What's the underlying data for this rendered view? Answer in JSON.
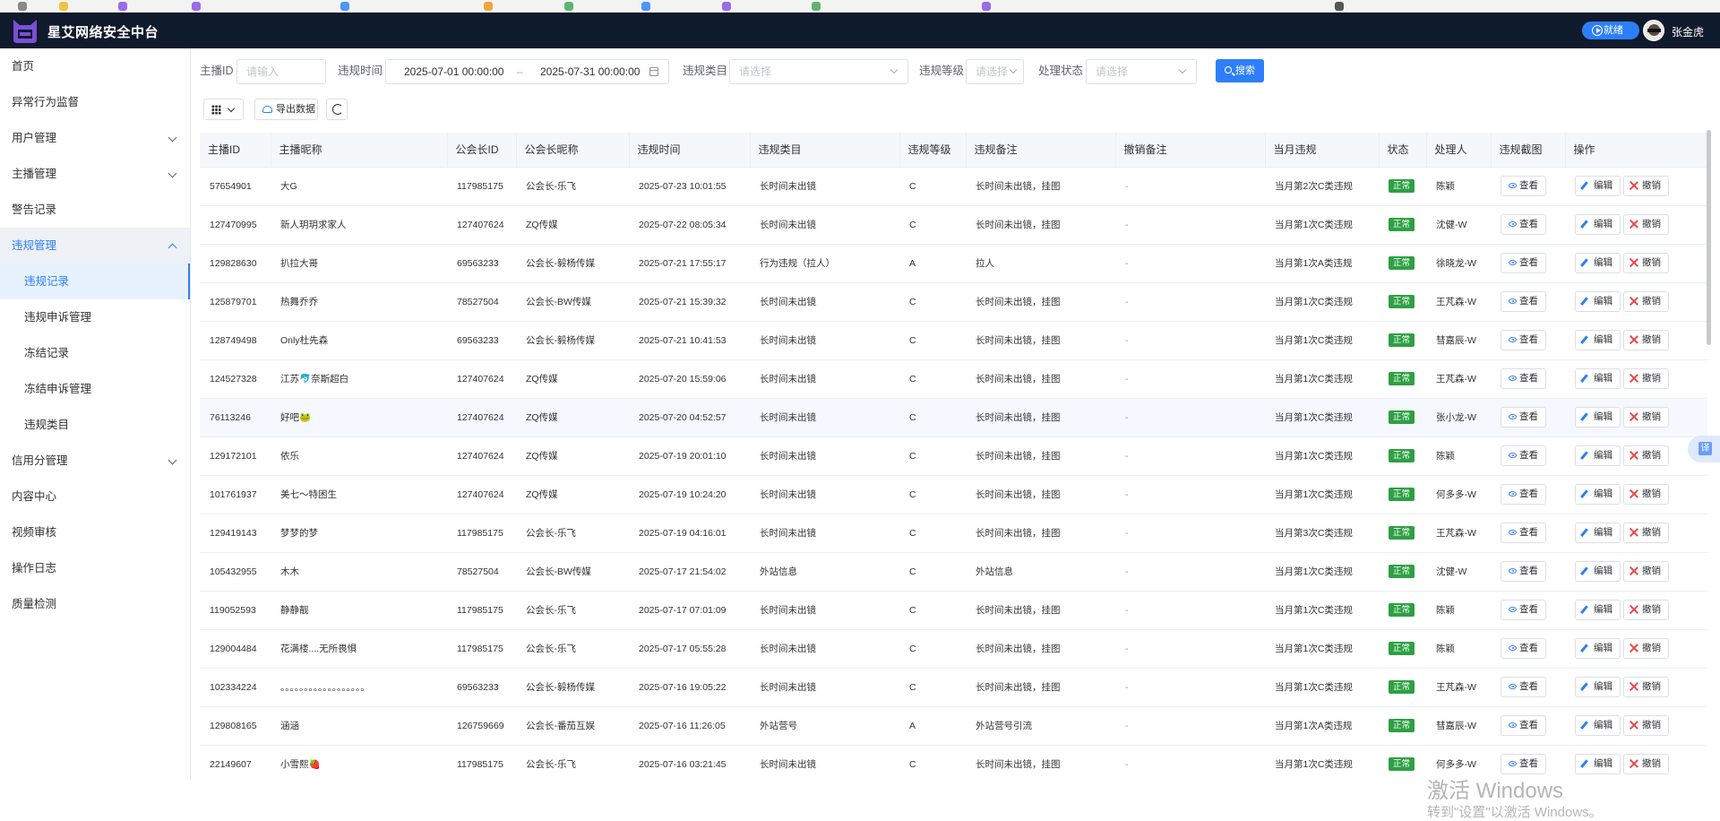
{
  "header": {
    "app_title": "星艾网络安全中台",
    "ready_label": "就绪",
    "user_name": "张金虎"
  },
  "sidebar": {
    "items": [
      {
        "label": "首页"
      },
      {
        "label": "异常行为监督"
      },
      {
        "label": "用户管理"
      },
      {
        "label": "主播管理"
      },
      {
        "label": "警告记录"
      },
      {
        "label": "违规管理"
      },
      {
        "label": "违规记录"
      },
      {
        "label": "违规申诉管理"
      },
      {
        "label": "冻结记录"
      },
      {
        "label": "冻结申诉管理"
      },
      {
        "label": "违规类目"
      },
      {
        "label": "信用分管理"
      },
      {
        "label": "内容中心"
      },
      {
        "label": "视频审核"
      },
      {
        "label": "操作日志"
      },
      {
        "label": "质量检测"
      }
    ]
  },
  "filters": {
    "anchor_id_label": "主播ID",
    "anchor_id_placeholder": "请输入",
    "time_label": "违规时间",
    "time_start": "2025-07-01 00:00:00",
    "time_sep": "–",
    "time_end": "2025-07-31 00:00:00",
    "category_label": "违规类目",
    "category_placeholder": "请选择",
    "level_label": "违规等级",
    "level_placeholder": "请选择",
    "status_label": "处理状态",
    "status_placeholder": "请选择",
    "search_label": "搜索"
  },
  "toolbar": {
    "export_label": "导出数据"
  },
  "table": {
    "columns": [
      "主播ID",
      "主播昵称",
      "公会长ID",
      "公会长昵称",
      "违规时间",
      "违规类目",
      "违规等级",
      "违规备注",
      "撤销备注",
      "当月违规",
      "状态",
      "处理人",
      "违规截图",
      "操作"
    ],
    "view_label": "查看",
    "edit_label": "编辑",
    "revoke_label": "撤销",
    "rows": [
      {
        "anchor_id": "57654901",
        "nickname": "大G",
        "guild_id": "117985175",
        "guild_name": "公会长-乐飞",
        "time": "2025-07-23 10:01:55",
        "category": "长时间未出镜",
        "level": "C",
        "remark": "长时间未出镜，挂图",
        "revoke_remark": "-",
        "monthly": "当月第2次C类违规",
        "status": "正常",
        "handler": "陈颖"
      },
      {
        "anchor_id": "127470995",
        "nickname": "新人玥玥求家人",
        "guild_id": "127407624",
        "guild_name": "ZQ传媒",
        "time": "2025-07-22 08:05:34",
        "category": "长时间未出镜",
        "level": "C",
        "remark": "长时间未出镜，挂图",
        "revoke_remark": "-",
        "monthly": "当月第1次C类违规",
        "status": "正常",
        "handler": "沈健-W"
      },
      {
        "anchor_id": "129828630",
        "nickname": "扒拉大哥",
        "guild_id": "69563233",
        "guild_name": "公会长-毅杨传媒",
        "time": "2025-07-21 17:55:17",
        "category": "行为违规（拉人）",
        "level": "A",
        "remark": "拉人",
        "revoke_remark": "-",
        "monthly": "当月第1次A类违规",
        "status": "正常",
        "handler": "徐晓龙-W"
      },
      {
        "anchor_id": "125879701",
        "nickname": "热舞乔乔",
        "guild_id": "78527504",
        "guild_name": "公会长-BW传媒",
        "time": "2025-07-21 15:39:32",
        "category": "长时间未出镜",
        "level": "C",
        "remark": "长时间未出镜，挂图",
        "revoke_remark": "-",
        "monthly": "当月第1次C类违规",
        "status": "正常",
        "handler": "王芃森-W"
      },
      {
        "anchor_id": "128749498",
        "nickname": "Only杜先森",
        "guild_id": "69563233",
        "guild_name": "公会长-毅杨传媒",
        "time": "2025-07-21 10:41:53",
        "category": "长时间未出镜",
        "level": "C",
        "remark": "长时间未出镜，挂图",
        "revoke_remark": "-",
        "monthly": "当月第1次C类违规",
        "status": "正常",
        "handler": "彗嘉辰-W"
      },
      {
        "anchor_id": "124527328",
        "nickname": "江苏🐬奈斯超白",
        "guild_id": "127407624",
        "guild_name": "ZQ传媒",
        "time": "2025-07-20 15:59:06",
        "category": "长时间未出镜",
        "level": "C",
        "remark": "长时间未出镜，挂图",
        "revoke_remark": "-",
        "monthly": "当月第1次C类违规",
        "status": "正常",
        "handler": "王芃森-W"
      },
      {
        "anchor_id": "76113246",
        "nickname": "好吧🐸",
        "guild_id": "127407624",
        "guild_name": "ZQ传媒",
        "time": "2025-07-20 04:52:57",
        "category": "长时间未出镜",
        "level": "C",
        "remark": "长时间未出镜，挂图",
        "revoke_remark": "-",
        "monthly": "当月第1次C类违规",
        "status": "正常",
        "handler": "张小龙-W"
      },
      {
        "anchor_id": "129172101",
        "nickname": "依乐",
        "guild_id": "127407624",
        "guild_name": "ZQ传媒",
        "time": "2025-07-19 20:01:10",
        "category": "长时间未出镜",
        "level": "C",
        "remark": "长时间未出镜，挂图",
        "revoke_remark": "-",
        "monthly": "当月第1次C类违规",
        "status": "正常",
        "handler": "陈颖"
      },
      {
        "anchor_id": "101761937",
        "nickname": "美七～特困生",
        "guild_id": "127407624",
        "guild_name": "ZQ传媒",
        "time": "2025-07-19 10:24:20",
        "category": "长时间未出镜",
        "level": "C",
        "remark": "长时间未出镜，挂图",
        "revoke_remark": "-",
        "monthly": "当月第1次C类违规",
        "status": "正常",
        "handler": "何多多-W"
      },
      {
        "anchor_id": "129419143",
        "nickname": "梦梦的梦",
        "guild_id": "117985175",
        "guild_name": "公会长-乐飞",
        "time": "2025-07-19 04:16:01",
        "category": "长时间未出镜",
        "level": "C",
        "remark": "长时间未出镜，挂图",
        "revoke_remark": "-",
        "monthly": "当月第3次C类违规",
        "status": "正常",
        "handler": "王芃森-W"
      },
      {
        "anchor_id": "105432955",
        "nickname": "木木",
        "guild_id": "78527504",
        "guild_name": "公会长-BW传媒",
        "time": "2025-07-17 21:54:02",
        "category": "外站信息",
        "level": "C",
        "remark": "外站信息",
        "revoke_remark": "-",
        "monthly": "当月第1次C类违规",
        "status": "正常",
        "handler": "沈健-W"
      },
      {
        "anchor_id": "119052593",
        "nickname": "静静靓",
        "guild_id": "117985175",
        "guild_name": "公会长-乐飞",
        "time": "2025-07-17 07:01:09",
        "category": "长时间未出镜",
        "level": "C",
        "remark": "长时间未出镜，挂图",
        "revoke_remark": "-",
        "monthly": "当月第1次C类违规",
        "status": "正常",
        "handler": "陈颖"
      },
      {
        "anchor_id": "129004484",
        "nickname": "花满楼....无所畏惧",
        "guild_id": "117985175",
        "guild_name": "公会长-乐飞",
        "time": "2025-07-17 05:55:28",
        "category": "长时间未出镜",
        "level": "C",
        "remark": "长时间未出镜，挂图",
        "revoke_remark": "-",
        "monthly": "当月第1次C类违规",
        "status": "正常",
        "handler": "陈颖"
      },
      {
        "anchor_id": "102334224",
        "nickname": "。。。。。。。。。。。。。。。。。。",
        "guild_id": "69563233",
        "guild_name": "公会长-毅杨传媒",
        "time": "2025-07-16 19:05:22",
        "category": "长时间未出镜",
        "level": "C",
        "remark": "长时间未出镜，挂图",
        "revoke_remark": "-",
        "monthly": "当月第1次C类违规",
        "status": "正常",
        "handler": "王芃森-W"
      },
      {
        "anchor_id": "129808165",
        "nickname": "涵涵",
        "guild_id": "126759669",
        "guild_name": "公会长-番茄互娱",
        "time": "2025-07-16 11:26:05",
        "category": "外站营号",
        "level": "A",
        "remark": "外站营号引流",
        "revoke_remark": "-",
        "monthly": "当月第1次A类违规",
        "status": "正常",
        "handler": "彗嘉辰-W"
      },
      {
        "anchor_id": "22149607",
        "nickname": "小雪熙🍓",
        "guild_id": "117985175",
        "guild_name": "公会长-乐飞",
        "time": "2025-07-16 03:21:45",
        "category": "长时间未出镜",
        "level": "C",
        "remark": "长时间未出镜，挂图",
        "revoke_remark": "-",
        "monthly": "当月第1次C类违规",
        "status": "正常",
        "handler": "何多多-W"
      }
    ]
  },
  "watermark": {
    "line1": "激活 Windows",
    "line2": "转到\"设置\"以激活 Windows。"
  },
  "colors": {
    "primary": "#2d7ff9",
    "topbar": "#0f1a2c",
    "status_ok": "#2ea043",
    "revoke": "#e54848"
  }
}
